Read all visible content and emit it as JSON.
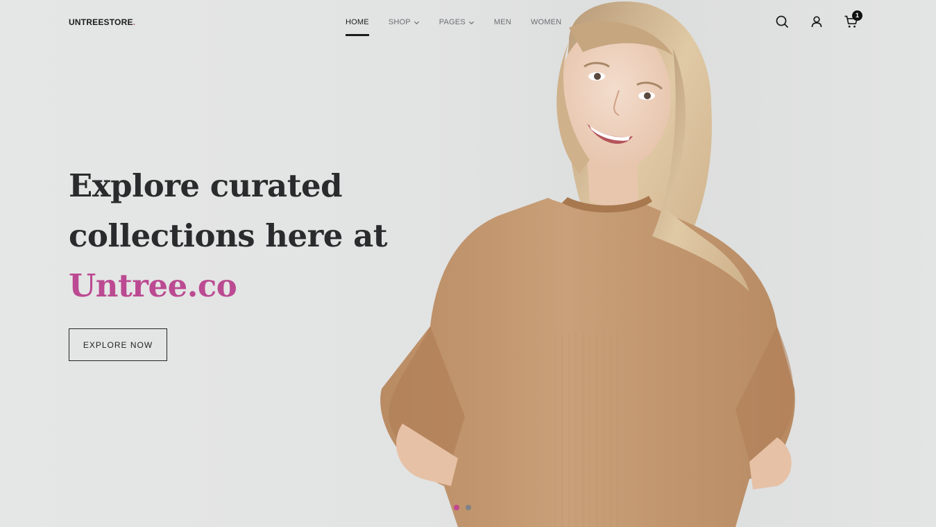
{
  "header": {
    "logo_text": "UNTREESTORE",
    "logo_dot": ".",
    "nav": [
      {
        "label": "HOME",
        "has_dropdown": false,
        "active": true
      },
      {
        "label": "SHOP",
        "has_dropdown": true,
        "active": false
      },
      {
        "label": "PAGES",
        "has_dropdown": true,
        "active": false
      },
      {
        "label": "MEN",
        "has_dropdown": false,
        "active": false
      },
      {
        "label": "WOMEN",
        "has_dropdown": false,
        "active": false
      }
    ],
    "icons": [
      "search-icon",
      "user-icon",
      "cart-icon"
    ],
    "cart_count": "1"
  },
  "hero": {
    "line1": "Explore curated",
    "line2": "collections here at",
    "accent": "Untree.co",
    "cta_label": "EXPLORE NOW",
    "slides": 2,
    "active_slide": 1
  },
  "colors": {
    "accent": "#c0478f",
    "text": "#2a2b2c",
    "background": "#e3e4e4",
    "sweater": "#c49a72"
  }
}
